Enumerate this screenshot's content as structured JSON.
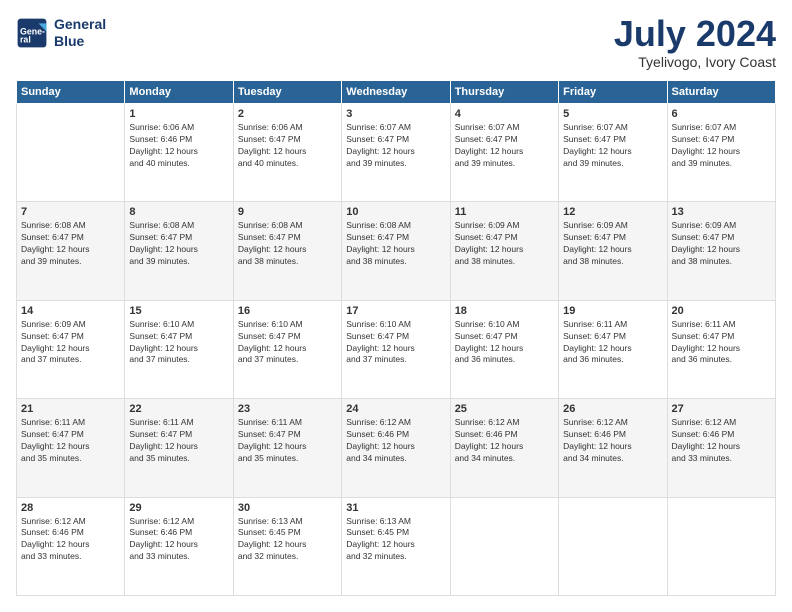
{
  "logo": {
    "line1": "General",
    "line2": "Blue"
  },
  "title": "July 2024",
  "subtitle": "Tyelivogo, Ivory Coast",
  "days_of_week": [
    "Sunday",
    "Monday",
    "Tuesday",
    "Wednesday",
    "Thursday",
    "Friday",
    "Saturday"
  ],
  "weeks": [
    [
      {
        "day": "",
        "info": ""
      },
      {
        "day": "1",
        "info": "Sunrise: 6:06 AM\nSunset: 6:46 PM\nDaylight: 12 hours\nand 40 minutes."
      },
      {
        "day": "2",
        "info": "Sunrise: 6:06 AM\nSunset: 6:47 PM\nDaylight: 12 hours\nand 40 minutes."
      },
      {
        "day": "3",
        "info": "Sunrise: 6:07 AM\nSunset: 6:47 PM\nDaylight: 12 hours\nand 39 minutes."
      },
      {
        "day": "4",
        "info": "Sunrise: 6:07 AM\nSunset: 6:47 PM\nDaylight: 12 hours\nand 39 minutes."
      },
      {
        "day": "5",
        "info": "Sunrise: 6:07 AM\nSunset: 6:47 PM\nDaylight: 12 hours\nand 39 minutes."
      },
      {
        "day": "6",
        "info": "Sunrise: 6:07 AM\nSunset: 6:47 PM\nDaylight: 12 hours\nand 39 minutes."
      }
    ],
    [
      {
        "day": "7",
        "info": ""
      },
      {
        "day": "8",
        "info": "Sunrise: 6:08 AM\nSunset: 6:47 PM\nDaylight: 12 hours\nand 39 minutes."
      },
      {
        "day": "9",
        "info": "Sunrise: 6:08 AM\nSunset: 6:47 PM\nDaylight: 12 hours\nand 38 minutes."
      },
      {
        "day": "10",
        "info": "Sunrise: 6:08 AM\nSunset: 6:47 PM\nDaylight: 12 hours\nand 38 minutes."
      },
      {
        "day": "11",
        "info": "Sunrise: 6:09 AM\nSunset: 6:47 PM\nDaylight: 12 hours\nand 38 minutes."
      },
      {
        "day": "12",
        "info": "Sunrise: 6:09 AM\nSunset: 6:47 PM\nDaylight: 12 hours\nand 38 minutes."
      },
      {
        "day": "13",
        "info": "Sunrise: 6:09 AM\nSunset: 6:47 PM\nDaylight: 12 hours\nand 38 minutes."
      }
    ],
    [
      {
        "day": "14",
        "info": ""
      },
      {
        "day": "15",
        "info": "Sunrise: 6:10 AM\nSunset: 6:47 PM\nDaylight: 12 hours\nand 37 minutes."
      },
      {
        "day": "16",
        "info": "Sunrise: 6:10 AM\nSunset: 6:47 PM\nDaylight: 12 hours\nand 37 minutes."
      },
      {
        "day": "17",
        "info": "Sunrise: 6:10 AM\nSunset: 6:47 PM\nDaylight: 12 hours\nand 37 minutes."
      },
      {
        "day": "18",
        "info": "Sunrise: 6:10 AM\nSunset: 6:47 PM\nDaylight: 12 hours\nand 36 minutes."
      },
      {
        "day": "19",
        "info": "Sunrise: 6:11 AM\nSunset: 6:47 PM\nDaylight: 12 hours\nand 36 minutes."
      },
      {
        "day": "20",
        "info": "Sunrise: 6:11 AM\nSunset: 6:47 PM\nDaylight: 12 hours\nand 36 minutes."
      }
    ],
    [
      {
        "day": "21",
        "info": ""
      },
      {
        "day": "22",
        "info": "Sunrise: 6:11 AM\nSunset: 6:47 PM\nDaylight: 12 hours\nand 35 minutes."
      },
      {
        "day": "23",
        "info": "Sunrise: 6:11 AM\nSunset: 6:47 PM\nDaylight: 12 hours\nand 35 minutes."
      },
      {
        "day": "24",
        "info": "Sunrise: 6:12 AM\nSunset: 6:46 PM\nDaylight: 12 hours\nand 34 minutes."
      },
      {
        "day": "25",
        "info": "Sunrise: 6:12 AM\nSunset: 6:46 PM\nDaylight: 12 hours\nand 34 minutes."
      },
      {
        "day": "26",
        "info": "Sunrise: 6:12 AM\nSunset: 6:46 PM\nDaylight: 12 hours\nand 34 minutes."
      },
      {
        "day": "27",
        "info": "Sunrise: 6:12 AM\nSunset: 6:46 PM\nDaylight: 12 hours\nand 33 minutes."
      }
    ],
    [
      {
        "day": "28",
        "info": "Sunrise: 6:12 AM\nSunset: 6:46 PM\nDaylight: 12 hours\nand 33 minutes."
      },
      {
        "day": "29",
        "info": "Sunrise: 6:12 AM\nSunset: 6:46 PM\nDaylight: 12 hours\nand 33 minutes."
      },
      {
        "day": "30",
        "info": "Sunrise: 6:13 AM\nSunset: 6:45 PM\nDaylight: 12 hours\nand 32 minutes."
      },
      {
        "day": "31",
        "info": "Sunrise: 6:13 AM\nSunset: 6:45 PM\nDaylight: 12 hours\nand 32 minutes."
      },
      {
        "day": "",
        "info": ""
      },
      {
        "day": "",
        "info": ""
      },
      {
        "day": "",
        "info": ""
      }
    ]
  ],
  "week1_sunday_info": "Sunrise: 6:08 AM\nSunset: 6:47 PM\nDaylight: 12 hours\nand 39 minutes.",
  "week3_sunday_info": "Sunrise: 6:09 AM\nSunset: 6:47 PM\nDaylight: 12 hours\nand 37 minutes.",
  "week4_sunday_info": "Sunrise: 6:11 AM\nSunset: 6:47 PM\nDaylight: 12 hours\nand 35 minutes."
}
